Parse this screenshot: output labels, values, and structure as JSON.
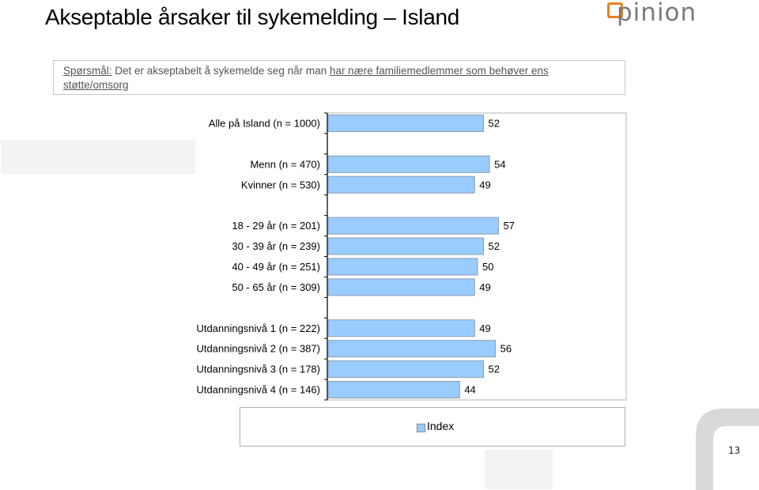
{
  "page": {
    "title": "Akseptable årsaker til sykemelding – Island",
    "logo_text": "pinion",
    "page_number": "13"
  },
  "question": {
    "prefix": "Spørsmål:",
    "text_plain": " Det er akseptabelt å sykemelde seg når man ",
    "text_underlined": "har nære familiemedlemmer som behøver ens støtte/omsorg"
  },
  "colors": {
    "bar_fill": "#99ccff",
    "bar_stroke": "#8c9cb0",
    "logo_orange": "#e8821e",
    "logo_gray": "#7a7a7a"
  },
  "chart_data": {
    "type": "bar",
    "orientation": "horizontal",
    "title": "",
    "xlabel": "",
    "ylabel": "",
    "xlim": [
      0,
      100
    ],
    "grid": false,
    "legend": {
      "position": "bottom",
      "entries": [
        "Index"
      ]
    },
    "series": [
      {
        "name": "Index",
        "groups": [
          {
            "rows": [
              {
                "label": "Alle på Island (n = 1000)",
                "value": 52
              }
            ]
          },
          {
            "rows": [
              {
                "label": "Menn (n = 470)",
                "value": 54
              },
              {
                "label": "Kvinner (n = 530)",
                "value": 49
              }
            ]
          },
          {
            "rows": [
              {
                "label": "18 - 29 år (n = 201)",
                "value": 57
              },
              {
                "label": "30 - 39 år (n = 239)",
                "value": 52
              },
              {
                "label": "40 - 49 år (n = 251)",
                "value": 50
              },
              {
                "label": "50 - 65 år (n = 309)",
                "value": 49
              }
            ]
          },
          {
            "rows": [
              {
                "label": "Utdanningsnivå 1 (n = 222)",
                "value": 49
              },
              {
                "label": "Utdanningsnivå 2 (n = 387)",
                "value": 56
              },
              {
                "label": "Utdanningsnivå 3 (n = 178)",
                "value": 52
              },
              {
                "label": "Utdanningsnivå 4 (n = 146)",
                "value": 44
              }
            ]
          }
        ]
      }
    ]
  }
}
